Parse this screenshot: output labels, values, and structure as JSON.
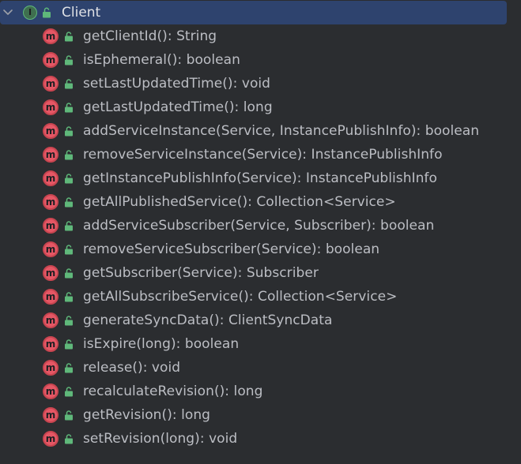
{
  "root": {
    "label": "Client",
    "kind_icon": "interface-icon",
    "kind_letter": "I",
    "expanded": true
  },
  "methods": [
    {
      "label": "getClientId(): String"
    },
    {
      "label": "isEphemeral(): boolean"
    },
    {
      "label": "setLastUpdatedTime(): void"
    },
    {
      "label": "getLastUpdatedTime(): long"
    },
    {
      "label": "addServiceInstance(Service, InstancePublishInfo): boolean"
    },
    {
      "label": "removeServiceInstance(Service): InstancePublishInfo"
    },
    {
      "label": "getInstancePublishInfo(Service): InstancePublishInfo"
    },
    {
      "label": "getAllPublishedService(): Collection<Service>"
    },
    {
      "label": "addServiceSubscriber(Service, Subscriber): boolean"
    },
    {
      "label": "removeServiceSubscriber(Service): boolean"
    },
    {
      "label": "getSubscriber(Service): Subscriber"
    },
    {
      "label": "getAllSubscribeService(): Collection<Service>"
    },
    {
      "label": "generateSyncData(): ClientSyncData"
    },
    {
      "label": "isExpire(long): boolean"
    },
    {
      "label": "release(): void"
    },
    {
      "label": "recalculateRevision(): long"
    },
    {
      "label": "getRevision(): long"
    },
    {
      "label": "setRevision(long): void"
    }
  ],
  "icons": {
    "method_letter": "m",
    "method_icon": "method-icon",
    "visibility_icon": "public-lock-icon"
  },
  "colors": {
    "background": "#2b2d30",
    "selection": "#2e436e",
    "text": "#bcbec4",
    "method_badge": "#e55765",
    "interface_badge": "#5fb87a",
    "lock": "#5fb87a"
  }
}
